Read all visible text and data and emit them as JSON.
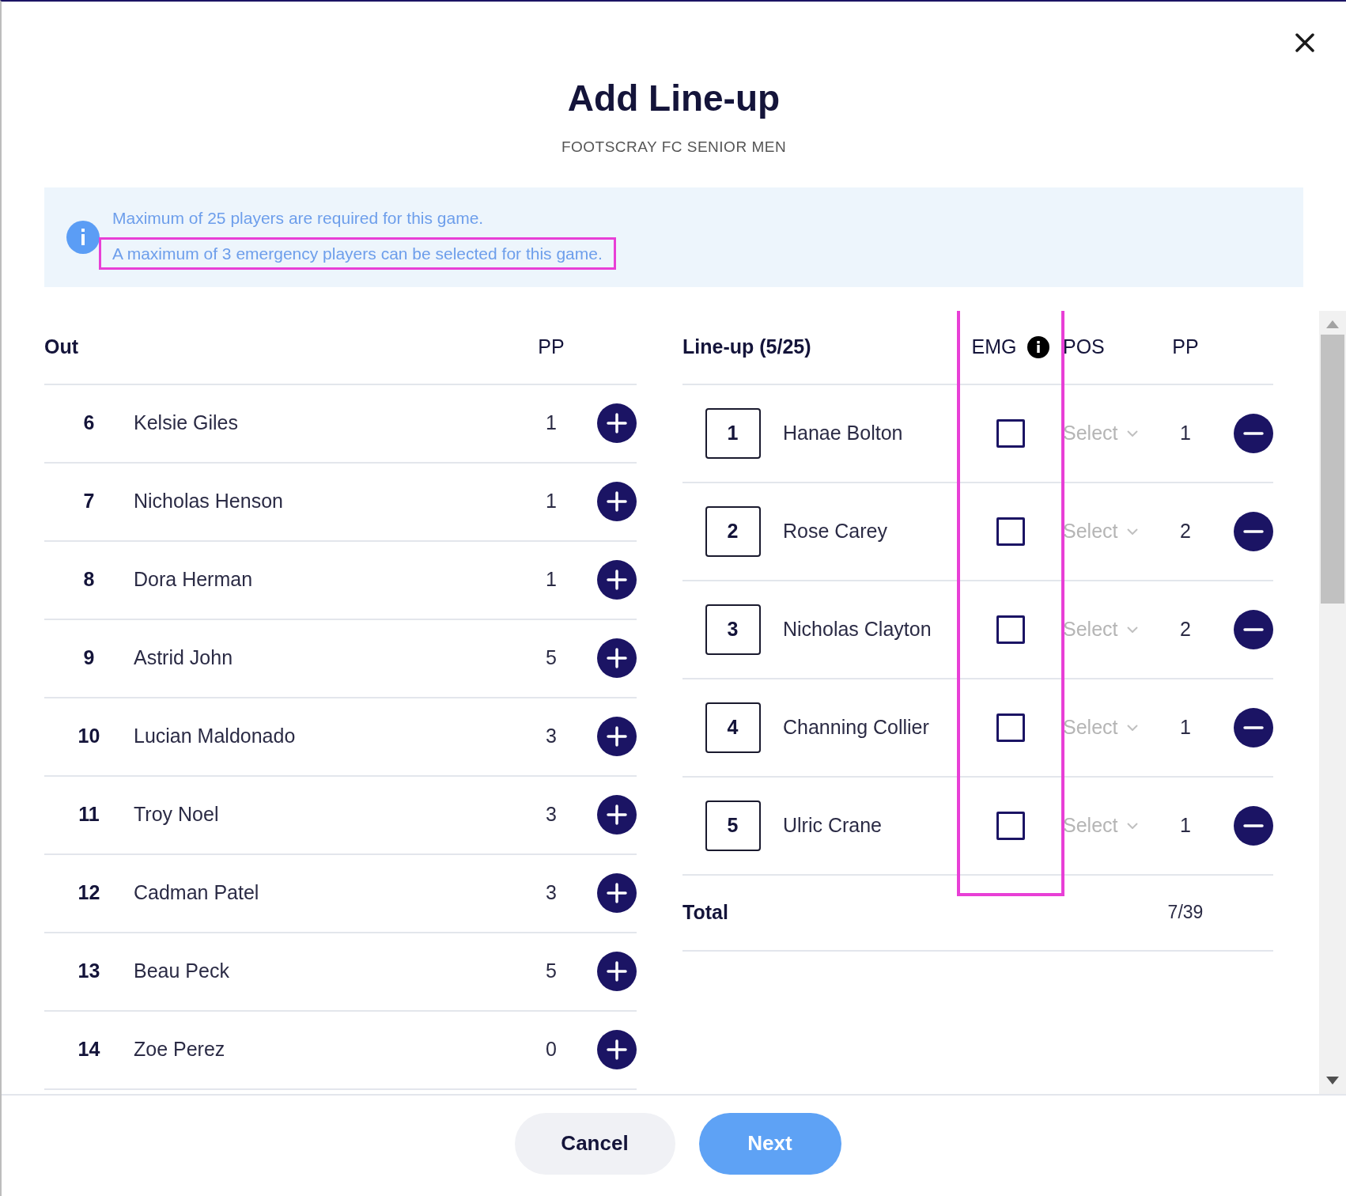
{
  "dialog": {
    "title": "Add Line-up",
    "subtitle": "FOOTSCRAY FC SENIOR MEN"
  },
  "info": {
    "messages": [
      {
        "text": "Maximum of 25 players are required for this game.",
        "highlighted": false
      },
      {
        "text": "A maximum of 3 emergency players can be selected for this game.",
        "highlighted": true
      }
    ]
  },
  "out_table": {
    "columns": [
      "Out",
      "PP"
    ],
    "rows": [
      {
        "number": "6",
        "name": "Kelsie Giles",
        "pp": "1"
      },
      {
        "number": "7",
        "name": "Nicholas Henson",
        "pp": "1"
      },
      {
        "number": "8",
        "name": "Dora Herman",
        "pp": "1"
      },
      {
        "number": "9",
        "name": "Astrid John",
        "pp": "5"
      },
      {
        "number": "10",
        "name": "Lucian Maldonado",
        "pp": "3"
      },
      {
        "number": "11",
        "name": "Troy Noel",
        "pp": "3"
      },
      {
        "number": "12",
        "name": "Cadman Patel",
        "pp": "3"
      },
      {
        "number": "13",
        "name": "Beau Peck",
        "pp": "5"
      },
      {
        "number": "14",
        "name": "Zoe Perez",
        "pp": "0"
      }
    ]
  },
  "lineup_table": {
    "columns": [
      {
        "label": "Line-up (5/25)",
        "highlighted": false,
        "info": false
      },
      {
        "label": "EMG",
        "highlighted": true,
        "info": true
      },
      {
        "label": "POS",
        "highlighted": false,
        "info": false
      },
      {
        "label": "PP",
        "highlighted": false,
        "info": false
      }
    ],
    "rows": [
      {
        "number": "1",
        "name": "Hanae Bolton",
        "checked": false,
        "position": {
          "placeholder": "Select"
        },
        "pp": "1"
      },
      {
        "number": "2",
        "name": "Rose Carey",
        "checked": false,
        "position": {
          "placeholder": "Select"
        },
        "pp": "2"
      },
      {
        "number": "3",
        "name": "Nicholas Clayton",
        "checked": false,
        "position": {
          "placeholder": "Select"
        },
        "pp": "2"
      },
      {
        "number": "4",
        "name": "Channing Collier",
        "checked": false,
        "position": {
          "placeholder": "Select"
        },
        "pp": "1"
      },
      {
        "number": "5",
        "name": "Ulric Crane",
        "checked": false,
        "position": {
          "placeholder": "Select"
        },
        "pp": "1"
      }
    ],
    "total": {
      "label": "Total",
      "value": "7/39"
    }
  },
  "buttons": [
    {
      "label": "Cancel",
      "kind": "secondary"
    },
    {
      "label": "Next",
      "kind": "primary"
    }
  ]
}
